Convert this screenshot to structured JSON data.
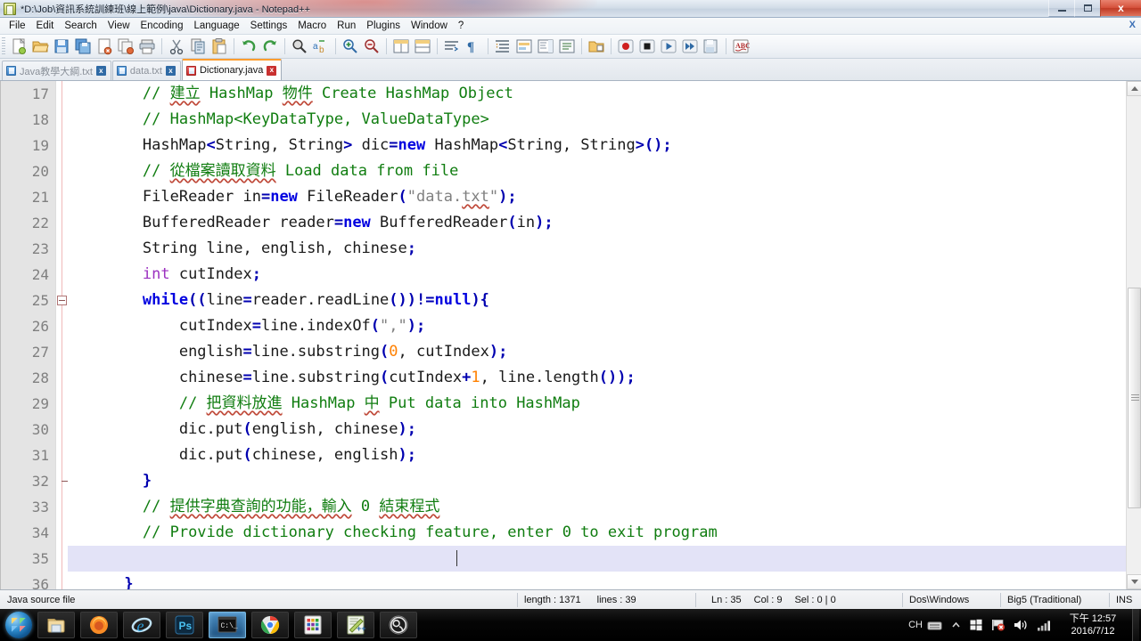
{
  "window": {
    "title": "*D:\\Job\\資訊系統訓練班\\線上範例\\java\\Dictionary.java - Notepad++",
    "minimize_label": "",
    "maximize_label": "",
    "close_label": "x"
  },
  "menubar": {
    "items": [
      {
        "label": "File"
      },
      {
        "label": "Edit"
      },
      {
        "label": "Search"
      },
      {
        "label": "View"
      },
      {
        "label": "Encoding"
      },
      {
        "label": "Language"
      },
      {
        "label": "Settings"
      },
      {
        "label": "Macro"
      },
      {
        "label": "Run"
      },
      {
        "label": "Plugins"
      },
      {
        "label": "Window"
      },
      {
        "label": "?"
      }
    ],
    "close_doc_label": "X"
  },
  "toolbar": {
    "icons": [
      "new-file-icon",
      "open-file-icon",
      "save-icon",
      "save-all-icon",
      "close-file-icon",
      "close-all-icon",
      "print-icon",
      "cut-icon",
      "copy-icon",
      "paste-icon",
      "undo-icon",
      "redo-icon",
      "find-icon",
      "replace-icon",
      "zoom-in-icon",
      "zoom-out-icon",
      "sync-vertical-icon",
      "sync-horizontal-icon",
      "word-wrap-icon",
      "show-all-chars-icon",
      "indent-guide-icon",
      "user-defined-dialog-icon",
      "document-map-icon",
      "function-list-icon",
      "folder-as-workspace-icon",
      "record-macro-icon",
      "stop-record-icon",
      "play-macro-icon",
      "run-macro-multiple-icon",
      "save-macro-icon",
      "spell-check-icon"
    ]
  },
  "tabs": [
    {
      "label": "Java教學大綱.txt",
      "active": false,
      "close_label": "x",
      "icon": "blue-disk-icon"
    },
    {
      "label": "data.txt",
      "active": false,
      "close_label": "x",
      "icon": "blue-disk-icon"
    },
    {
      "label": "Dictionary.java",
      "active": true,
      "close_label": "x",
      "icon": "red-disk-icon"
    }
  ],
  "editor": {
    "first_line_number": 17,
    "current_line_number": 35,
    "fold_marker_line": 25,
    "fold_end_line": 32,
    "lines": [
      {
        "n": "17",
        "tokens": [
          {
            "t": "        ",
            "c": ""
          },
          {
            "t": "// ",
            "c": "cl"
          },
          {
            "t": "建立",
            "c": "cl sq"
          },
          {
            "t": " HashMap ",
            "c": "cl"
          },
          {
            "t": "物件",
            "c": "cl sq"
          },
          {
            "t": " Create HashMap Object",
            "c": "cl"
          }
        ]
      },
      {
        "n": "18",
        "tokens": [
          {
            "t": "        ",
            "c": ""
          },
          {
            "t": "// HashMap<KeyDataType, ValueDataType>",
            "c": "cl"
          }
        ]
      },
      {
        "n": "19",
        "tokens": [
          {
            "t": "        ",
            "c": ""
          },
          {
            "t": "HashMap",
            "c": ""
          },
          {
            "t": "<",
            "c": "op"
          },
          {
            "t": "String, String",
            "c": ""
          },
          {
            "t": ">",
            "c": "op"
          },
          {
            "t": " dic",
            "c": ""
          },
          {
            "t": "=",
            "c": "op"
          },
          {
            "t": "new",
            "c": "kw"
          },
          {
            "t": " HashMap",
            "c": ""
          },
          {
            "t": "<",
            "c": "op"
          },
          {
            "t": "String, String",
            "c": ""
          },
          {
            "t": ">()",
            "c": "op"
          },
          {
            "t": ";",
            "c": "op"
          }
        ]
      },
      {
        "n": "20",
        "tokens": [
          {
            "t": "        ",
            "c": ""
          },
          {
            "t": "// ",
            "c": "cl"
          },
          {
            "t": "從檔案讀取資料",
            "c": "cl sq"
          },
          {
            "t": " Load data from file",
            "c": "cl"
          }
        ]
      },
      {
        "n": "21",
        "tokens": [
          {
            "t": "        ",
            "c": ""
          },
          {
            "t": "FileReader in",
            "c": ""
          },
          {
            "t": "=",
            "c": "op"
          },
          {
            "t": "new",
            "c": "kw"
          },
          {
            "t": " FileReader",
            "c": ""
          },
          {
            "t": "(",
            "c": "op"
          },
          {
            "t": "\"data.",
            "c": "st"
          },
          {
            "t": "txt",
            "c": "st sq"
          },
          {
            "t": "\"",
            "c": "st"
          },
          {
            "t": ")",
            "c": "op"
          },
          {
            "t": ";",
            "c": "op"
          }
        ]
      },
      {
        "n": "22",
        "tokens": [
          {
            "t": "        ",
            "c": ""
          },
          {
            "t": "BufferedReader reader",
            "c": ""
          },
          {
            "t": "=",
            "c": "op"
          },
          {
            "t": "new",
            "c": "kw"
          },
          {
            "t": " BufferedReader",
            "c": ""
          },
          {
            "t": "(",
            "c": "op"
          },
          {
            "t": "in",
            "c": ""
          },
          {
            "t": ")",
            "c": "op"
          },
          {
            "t": ";",
            "c": "op"
          }
        ]
      },
      {
        "n": "23",
        "tokens": [
          {
            "t": "        ",
            "c": ""
          },
          {
            "t": "String line, english, chinese",
            "c": ""
          },
          {
            "t": ";",
            "c": "op"
          }
        ]
      },
      {
        "n": "24",
        "tokens": [
          {
            "t": "        ",
            "c": ""
          },
          {
            "t": "int",
            "c": "ty"
          },
          {
            "t": " cutIndex",
            "c": ""
          },
          {
            "t": ";",
            "c": "op"
          }
        ]
      },
      {
        "n": "25",
        "tokens": [
          {
            "t": "        ",
            "c": ""
          },
          {
            "t": "while",
            "c": "kw"
          },
          {
            "t": "((",
            "c": "op"
          },
          {
            "t": "line",
            "c": ""
          },
          {
            "t": "=",
            "c": "op"
          },
          {
            "t": "reader.readLine",
            "c": ""
          },
          {
            "t": "())!=",
            "c": "op"
          },
          {
            "t": "null",
            "c": "kw"
          },
          {
            "t": "){",
            "c": "op"
          }
        ]
      },
      {
        "n": "26",
        "tokens": [
          {
            "t": "            ",
            "c": ""
          },
          {
            "t": "cutIndex",
            "c": ""
          },
          {
            "t": "=",
            "c": "op"
          },
          {
            "t": "line.indexOf",
            "c": ""
          },
          {
            "t": "(",
            "c": "op"
          },
          {
            "t": "\",\"",
            "c": "st"
          },
          {
            "t": ")",
            "c": "op"
          },
          {
            "t": ";",
            "c": "op"
          }
        ]
      },
      {
        "n": "27",
        "tokens": [
          {
            "t": "            ",
            "c": ""
          },
          {
            "t": "english",
            "c": ""
          },
          {
            "t": "=",
            "c": "op"
          },
          {
            "t": "line.substring",
            "c": ""
          },
          {
            "t": "(",
            "c": "op"
          },
          {
            "t": "0",
            "c": "num"
          },
          {
            "t": ", cutIndex",
            "c": ""
          },
          {
            "t": ")",
            "c": "op"
          },
          {
            "t": ";",
            "c": "op"
          }
        ]
      },
      {
        "n": "28",
        "tokens": [
          {
            "t": "            ",
            "c": ""
          },
          {
            "t": "chinese",
            "c": ""
          },
          {
            "t": "=",
            "c": "op"
          },
          {
            "t": "line.substring",
            "c": ""
          },
          {
            "t": "(",
            "c": "op"
          },
          {
            "t": "cutIndex",
            "c": ""
          },
          {
            "t": "+",
            "c": "op"
          },
          {
            "t": "1",
            "c": "num"
          },
          {
            "t": ", line.length",
            "c": ""
          },
          {
            "t": "())",
            "c": "op"
          },
          {
            "t": ";",
            "c": "op"
          }
        ]
      },
      {
        "n": "29",
        "tokens": [
          {
            "t": "            ",
            "c": ""
          },
          {
            "t": "// ",
            "c": "cl"
          },
          {
            "t": "把資料放進",
            "c": "cl sq"
          },
          {
            "t": " HashMap ",
            "c": "cl"
          },
          {
            "t": "中",
            "c": "cl sq"
          },
          {
            "t": " Put data into HashMap",
            "c": "cl"
          }
        ]
      },
      {
        "n": "30",
        "tokens": [
          {
            "t": "            ",
            "c": ""
          },
          {
            "t": "dic.put",
            "c": ""
          },
          {
            "t": "(",
            "c": "op"
          },
          {
            "t": "english, chinese",
            "c": ""
          },
          {
            "t": ")",
            "c": "op"
          },
          {
            "t": ";",
            "c": "op"
          }
        ]
      },
      {
        "n": "31",
        "tokens": [
          {
            "t": "            ",
            "c": ""
          },
          {
            "t": "dic.put",
            "c": ""
          },
          {
            "t": "(",
            "c": "op"
          },
          {
            "t": "chinese, english",
            "c": ""
          },
          {
            "t": ")",
            "c": "op"
          },
          {
            "t": ";",
            "c": "op"
          }
        ]
      },
      {
        "n": "32",
        "tokens": [
          {
            "t": "        ",
            "c": ""
          },
          {
            "t": "}",
            "c": "op"
          }
        ]
      },
      {
        "n": "33",
        "tokens": [
          {
            "t": "        ",
            "c": ""
          },
          {
            "t": "// ",
            "c": "cl"
          },
          {
            "t": "提供字典查詢的功能，輸入",
            "c": "cl sq"
          },
          {
            "t": " 0 ",
            "c": "cl"
          },
          {
            "t": "結束程式",
            "c": "cl sq"
          }
        ]
      },
      {
        "n": "34",
        "tokens": [
          {
            "t": "        ",
            "c": ""
          },
          {
            "t": "// Provide dictionary checking feature, enter 0 to exit program",
            "c": "cl"
          }
        ]
      },
      {
        "n": "35",
        "tokens": [
          {
            "t": "",
            "c": ""
          }
        ]
      },
      {
        "n": "36",
        "tokens": [
          {
            "t": "      ",
            "c": ""
          },
          {
            "t": "}",
            "c": "op"
          }
        ]
      }
    ]
  },
  "statusbar": {
    "file_type": "Java source file",
    "length": "length : 1371",
    "lines": "lines : 39",
    "ln": "Ln : 35",
    "col": "Col : 9",
    "sel": "Sel : 0 | 0",
    "eol": "Dos\\Windows",
    "encoding": "Big5 (Traditional)",
    "insert_mode": "INS"
  },
  "taskbar": {
    "start_label": "start-orb",
    "items": [
      {
        "name": "file-explorer-icon"
      },
      {
        "name": "firefox-icon"
      },
      {
        "name": "internet-explorer-icon"
      },
      {
        "name": "photoshop-icon",
        "label": "Ps"
      },
      {
        "name": "command-prompt-icon",
        "label": "C:\\",
        "active": true
      },
      {
        "name": "google-chrome-icon"
      },
      {
        "name": "app-grid-icon"
      },
      {
        "name": "notepad-plus-plus-icon"
      },
      {
        "name": "obs-studio-icon"
      }
    ],
    "tray": {
      "language": "CH",
      "keyboard_icon": "keyboard-icon",
      "overflow_icon": "show-hidden-icons-icon",
      "windows_icon": "windows-update-icon",
      "flag_icon": "action-center-icon",
      "volume_icon": "volume-icon",
      "network_icon": "network-signal-icon",
      "time": "下午 12:57",
      "date": "2016/7/12"
    }
  }
}
